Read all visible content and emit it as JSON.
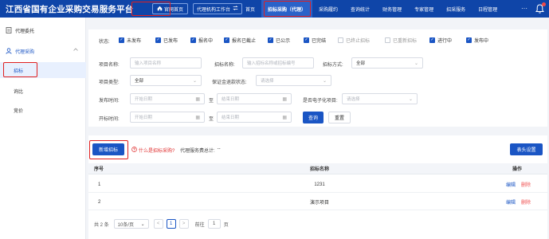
{
  "header": {
    "title": "江西省国有企业采购交易服务平台",
    "portal_label": "官网首页",
    "workbench_label": "代理机构工作台",
    "nav": [
      "首页",
      "招标采购（代理）",
      "采购履约",
      "查询统计",
      "财务管理",
      "专家管理",
      "招采服务",
      "日程管理"
    ],
    "more": "···"
  },
  "sidebar": {
    "item_entrust": "代理委托",
    "group_purchase": "代理采购",
    "items": [
      "招标",
      "询比",
      "竞价"
    ]
  },
  "filters": {
    "status_label": "状态:",
    "statuses": [
      {
        "label": "未发布",
        "checked": true
      },
      {
        "label": "已发布",
        "checked": true
      },
      {
        "label": "报名中",
        "checked": true
      },
      {
        "label": "报名已截止",
        "checked": true
      },
      {
        "label": "已公示",
        "checked": true
      },
      {
        "label": "已完结",
        "checked": true
      },
      {
        "label": "已终止招标",
        "checked": false
      },
      {
        "label": "已重新招标",
        "checked": false
      },
      {
        "label": "进行中",
        "checked": true
      },
      {
        "label": "发布中",
        "checked": true
      }
    ],
    "project_name_label": "项目名称:",
    "project_name_placeholder": "输入项目名称",
    "tender_name_label": "招标名称:",
    "tender_name_placeholder": "输入招标名称或招标编号",
    "tender_method_label": "招标方式:",
    "tender_method_value": "全部",
    "project_type_label": "项目类型:",
    "project_type_value": "全部",
    "deposit_label": "保证金退款状态:",
    "deposit_placeholder": "请选择",
    "publish_time_label": "发布时间:",
    "start_date_placeholder": "开始日期",
    "to_label": "至",
    "end_date_placeholder": "结束日期",
    "electronic_label": "是否电子化项目:",
    "electronic_placeholder": "请选择",
    "open_time_label": "开标时间:",
    "query_button": "查询",
    "reset_button": "重置"
  },
  "toolbar": {
    "new_button": "新增招标",
    "help_link": "什么是招标采购?",
    "fee_label": "代理服务费总计:",
    "fee_value": "--",
    "header_settings": "表头设置"
  },
  "table": {
    "columns": [
      "序号",
      "招标名称",
      "操作"
    ],
    "rows": [
      {
        "index": "1",
        "name": "1231",
        "edit": "编辑",
        "delete": "删除"
      },
      {
        "index": "2",
        "name": "演示项目",
        "edit": "编辑",
        "delete": "删除"
      }
    ]
  },
  "pagination": {
    "total": "共 2 条",
    "page_size": "10条/页",
    "prev": "<",
    "current_page": "1",
    "next": ">",
    "goto_label": "前往",
    "goto_value": "1",
    "page_suffix": "页"
  },
  "colors": {
    "primary": "#1a55c4",
    "header_bg": "#0f45a8",
    "highlight_box": "#e02020",
    "delete": "#f05050"
  }
}
